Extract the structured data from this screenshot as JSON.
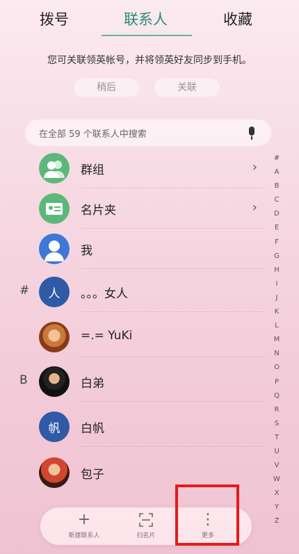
{
  "tabs": [
    "拨号",
    "联系人",
    "收藏"
  ],
  "promo": {
    "text": "您可关联领英帐号，并将领英好友同步到手机。",
    "later_label": "稍后",
    "link_label": "关联"
  },
  "search": {
    "placeholder": "在全部 59 个联系人中搜索"
  },
  "sections": {
    "hash": "#",
    "b": "B"
  },
  "contacts": [
    {
      "name": "群组",
      "avatar": "group-icon"
    },
    {
      "name": "名片夹",
      "avatar": "card-holder-icon"
    },
    {
      "name": "我",
      "avatar": "person-icon"
    },
    {
      "name": "。。。女人",
      "avatar_text": "人"
    },
    {
      "name": "=.= YuKi",
      "avatar": "photo"
    },
    {
      "name": "白弟",
      "avatar": "photo"
    },
    {
      "name": "白帆",
      "avatar_text": "帆"
    },
    {
      "name": "包子",
      "avatar": "photo"
    }
  ],
  "alphabet": [
    "#",
    "A",
    "B",
    "C",
    "D",
    "E",
    "F",
    "G",
    "H",
    "I",
    "J",
    "K",
    "L",
    "M",
    "N",
    "O",
    "P",
    "Q",
    "R",
    "S",
    "T",
    "U",
    "V",
    "W",
    "X",
    "Y",
    "Z"
  ],
  "bottom_bar": {
    "new_contact": "新建联系人",
    "scan_card": "扫名片",
    "more": "更多"
  },
  "colors": {
    "accent": "#2a8a7a",
    "highlight": "#e21b1b",
    "avatar_blue": "#2f5aa6",
    "avatar_green": "#5cb87a"
  }
}
